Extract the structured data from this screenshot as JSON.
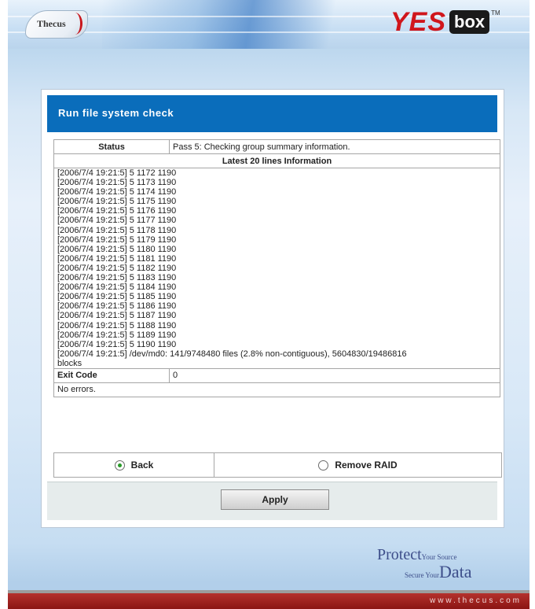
{
  "header": {
    "thecus_logo_text": "Thecus",
    "yes_logo_text": "YES",
    "box_logo_text": "box",
    "tm": "TM"
  },
  "panel": {
    "title": "Run file system check",
    "status_label": "Status",
    "status_value": "Pass 5: Checking group summary information.",
    "log_header": "Latest 20 lines Information",
    "log_lines": [
      "[2006/7/4 19:21:5] 5 1172 1190",
      "[2006/7/4 19:21:5] 5 1173 1190",
      "[2006/7/4 19:21:5] 5 1174 1190",
      "[2006/7/4 19:21:5] 5 1175 1190",
      "[2006/7/4 19:21:5] 5 1176 1190",
      "[2006/7/4 19:21:5] 5 1177 1190",
      "[2006/7/4 19:21:5] 5 1178 1190",
      "[2006/7/4 19:21:5] 5 1179 1190",
      "[2006/7/4 19:21:5] 5 1180 1190",
      "[2006/7/4 19:21:5] 5 1181 1190",
      "[2006/7/4 19:21:5] 5 1182 1190",
      "[2006/7/4 19:21:5] 5 1183 1190",
      "[2006/7/4 19:21:5] 5 1184 1190",
      "[2006/7/4 19:21:5] 5 1185 1190",
      "[2006/7/4 19:21:5] 5 1186 1190",
      "[2006/7/4 19:21:5] 5 1187 1190",
      "[2006/7/4 19:21:5] 5 1188 1190",
      "[2006/7/4 19:21:5] 5 1189 1190",
      "[2006/7/4 19:21:5] 5 1190 1190",
      "[2006/7/4 19:21:5] /dev/md0: 141/9748480 files (2.8% non-contiguous), 5604830/19486816",
      "blocks"
    ],
    "exit_code_label": "Exit Code",
    "exit_code_value": "0",
    "result_text": "No errors.",
    "options": [
      {
        "label": "Back",
        "selected": true
      },
      {
        "label": "Remove RAID",
        "selected": false
      }
    ],
    "apply_label": "Apply"
  },
  "tagline": {
    "protect": "Protect",
    "your_source": "Your Source",
    "secure_your": "Secure Your",
    "data": "Data"
  },
  "footer": {
    "url": "www.thecus.com"
  },
  "colors": {
    "title_bar": "#0a6dbb",
    "brand_red": "#d0161c",
    "footer_red": "#a3221f",
    "radio_selected": "#2a9a2a"
  }
}
